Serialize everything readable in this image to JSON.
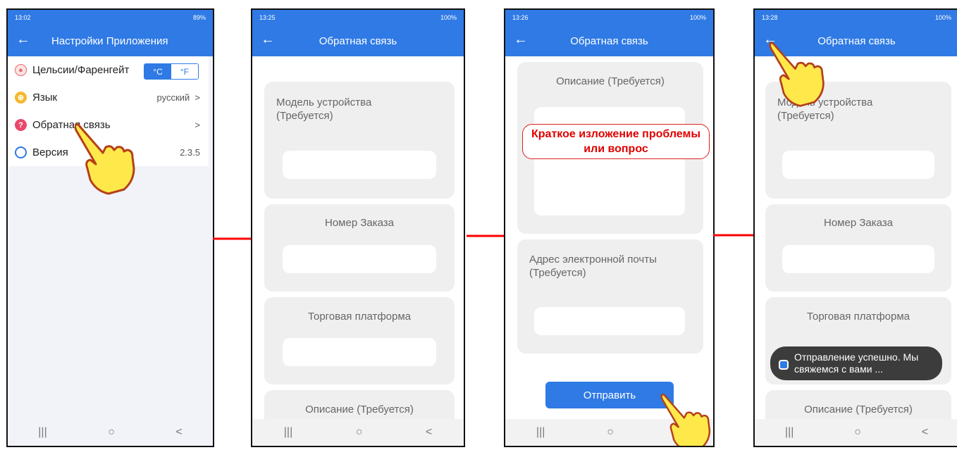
{
  "colors": {
    "accent": "#2f7ae5",
    "callout": "#e00000"
  },
  "screen1": {
    "status": {
      "time": "13:02",
      "right": "89%"
    },
    "title": "Настройки Приложения",
    "rows": [
      {
        "label": "Цельсии/Фаренгейт",
        "icon": "thermometer-icon",
        "opt_c": "°C",
        "opt_f": "°F"
      },
      {
        "label": "Язык",
        "value": "русский",
        "icon": "globe-icon",
        "chevron": ">"
      },
      {
        "label": "Обратная связь",
        "icon": "question-icon",
        "chevron": ">"
      },
      {
        "label": "Версия",
        "value": "2.3.5",
        "icon": "refresh-icon"
      }
    ]
  },
  "screen2": {
    "status": {
      "time": "13:25",
      "right": "100%"
    },
    "title": "Обратная связь",
    "fields": {
      "device_model": "Модель устройства (Требуется)",
      "order_number": "Номер Заказа",
      "platform": "Торговая платформа",
      "description": "Описание (Требуется)"
    }
  },
  "screen3": {
    "status": {
      "time": "13:26",
      "right": "100%"
    },
    "title": "Обратная связь",
    "fields": {
      "description": "Описание (Требуется)",
      "email": "Адрес электронной почты (Требуется)"
    },
    "callout": "Краткое изложение проблемы или вопрос",
    "submit": "Отправить"
  },
  "screen4": {
    "status": {
      "time": "13:28",
      "right": "100%"
    },
    "title": "Обратная связь",
    "fields": {
      "device_model": "Модель устройства (Требуется)",
      "order_number": "Номер Заказа",
      "platform": "Торговая платформа",
      "description": "Описание (Требуется)"
    },
    "toast": "Отправление успешно. Мы свяжемся с вами ..."
  },
  "nav": {
    "recent": "|||",
    "home": "○",
    "back": "<"
  },
  "back_arrow": "←"
}
